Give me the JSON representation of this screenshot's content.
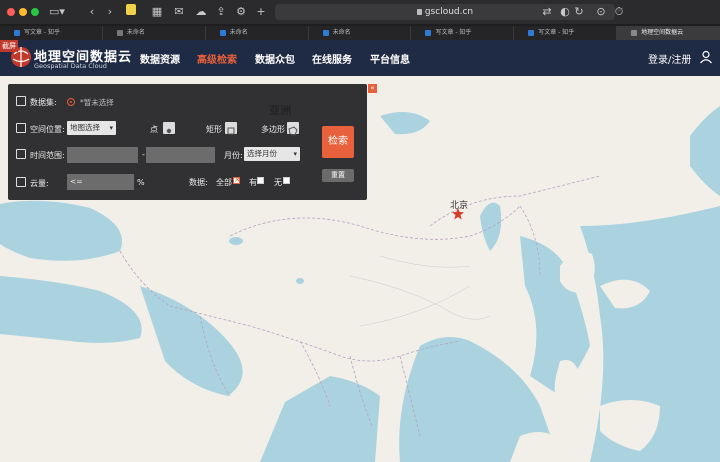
{
  "browser": {
    "url": "gscloud.cn",
    "tabs": [
      {
        "label": "写文章 - 知乎",
        "color": "#2e7bd6"
      },
      {
        "label": "未命名",
        "color": "#777777"
      },
      {
        "label": "未命名",
        "color": "#2e7bd6"
      },
      {
        "label": "未命名",
        "color": "#2e7bd6"
      },
      {
        "label": "写文章 - 知乎",
        "color": "#2e7bd6"
      },
      {
        "label": "写文章 - 知乎",
        "color": "#2e7bd6"
      },
      {
        "label": "地理空间数据云",
        "color": "#888888"
      }
    ]
  },
  "site": {
    "badge": "截屏",
    "title": "地理空间数据云",
    "subtitle": "Geospatial Data Cloud",
    "nav": [
      "数据资源",
      "高级检索",
      "数据众包",
      "在线服务",
      "平台信息"
    ],
    "active_nav": "高级检索",
    "login": "登录/注册"
  },
  "panel": {
    "dataset_label": "数据集:",
    "dataset_hint": "*暂未选择",
    "spatial_label": "空间位置:",
    "spatial_select": "地图选择",
    "point_label": "点",
    "rect_label": "矩形",
    "polygon_label": "多边形",
    "time_label": "时间范围:",
    "time_sep": "-",
    "month_label": "月份:",
    "month_select": "选择月份",
    "cloud_label": "云量:",
    "cloud_value": "<=",
    "cloud_unit": "%",
    "data_label": "数据:",
    "opt_all": "全部",
    "opt_yes": "有",
    "opt_no": "无",
    "search_button": "检索",
    "reset_button": "重置",
    "close": "«"
  },
  "map": {
    "region_label": "亚洲",
    "city_label": "北京"
  },
  "colors": {
    "accent": "#e8613c",
    "nav_bg": "#1f2a44",
    "water": "#aad3df",
    "land": "#f2efe9"
  }
}
